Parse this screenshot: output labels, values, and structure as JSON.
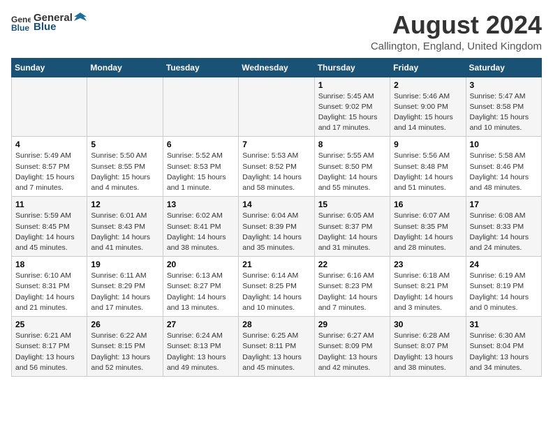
{
  "header": {
    "logo_general": "General",
    "logo_blue": "Blue",
    "main_title": "August 2024",
    "subtitle": "Callington, England, United Kingdom"
  },
  "weekdays": [
    "Sunday",
    "Monday",
    "Tuesday",
    "Wednesday",
    "Thursday",
    "Friday",
    "Saturday"
  ],
  "weeks": [
    [
      {
        "day": "",
        "info": ""
      },
      {
        "day": "",
        "info": ""
      },
      {
        "day": "",
        "info": ""
      },
      {
        "day": "",
        "info": ""
      },
      {
        "day": "1",
        "info": "Sunrise: 5:45 AM\nSunset: 9:02 PM\nDaylight: 15 hours and 17 minutes."
      },
      {
        "day": "2",
        "info": "Sunrise: 5:46 AM\nSunset: 9:00 PM\nDaylight: 15 hours and 14 minutes."
      },
      {
        "day": "3",
        "info": "Sunrise: 5:47 AM\nSunset: 8:58 PM\nDaylight: 15 hours and 10 minutes."
      }
    ],
    [
      {
        "day": "4",
        "info": "Sunrise: 5:49 AM\nSunset: 8:57 PM\nDaylight: 15 hours and 7 minutes."
      },
      {
        "day": "5",
        "info": "Sunrise: 5:50 AM\nSunset: 8:55 PM\nDaylight: 15 hours and 4 minutes."
      },
      {
        "day": "6",
        "info": "Sunrise: 5:52 AM\nSunset: 8:53 PM\nDaylight: 15 hours and 1 minute."
      },
      {
        "day": "7",
        "info": "Sunrise: 5:53 AM\nSunset: 8:52 PM\nDaylight: 14 hours and 58 minutes."
      },
      {
        "day": "8",
        "info": "Sunrise: 5:55 AM\nSunset: 8:50 PM\nDaylight: 14 hours and 55 minutes."
      },
      {
        "day": "9",
        "info": "Sunrise: 5:56 AM\nSunset: 8:48 PM\nDaylight: 14 hours and 51 minutes."
      },
      {
        "day": "10",
        "info": "Sunrise: 5:58 AM\nSunset: 8:46 PM\nDaylight: 14 hours and 48 minutes."
      }
    ],
    [
      {
        "day": "11",
        "info": "Sunrise: 5:59 AM\nSunset: 8:45 PM\nDaylight: 14 hours and 45 minutes."
      },
      {
        "day": "12",
        "info": "Sunrise: 6:01 AM\nSunset: 8:43 PM\nDaylight: 14 hours and 41 minutes."
      },
      {
        "day": "13",
        "info": "Sunrise: 6:02 AM\nSunset: 8:41 PM\nDaylight: 14 hours and 38 minutes."
      },
      {
        "day": "14",
        "info": "Sunrise: 6:04 AM\nSunset: 8:39 PM\nDaylight: 14 hours and 35 minutes."
      },
      {
        "day": "15",
        "info": "Sunrise: 6:05 AM\nSunset: 8:37 PM\nDaylight: 14 hours and 31 minutes."
      },
      {
        "day": "16",
        "info": "Sunrise: 6:07 AM\nSunset: 8:35 PM\nDaylight: 14 hours and 28 minutes."
      },
      {
        "day": "17",
        "info": "Sunrise: 6:08 AM\nSunset: 8:33 PM\nDaylight: 14 hours and 24 minutes."
      }
    ],
    [
      {
        "day": "18",
        "info": "Sunrise: 6:10 AM\nSunset: 8:31 PM\nDaylight: 14 hours and 21 minutes."
      },
      {
        "day": "19",
        "info": "Sunrise: 6:11 AM\nSunset: 8:29 PM\nDaylight: 14 hours and 17 minutes."
      },
      {
        "day": "20",
        "info": "Sunrise: 6:13 AM\nSunset: 8:27 PM\nDaylight: 14 hours and 13 minutes."
      },
      {
        "day": "21",
        "info": "Sunrise: 6:14 AM\nSunset: 8:25 PM\nDaylight: 14 hours and 10 minutes."
      },
      {
        "day": "22",
        "info": "Sunrise: 6:16 AM\nSunset: 8:23 PM\nDaylight: 14 hours and 7 minutes."
      },
      {
        "day": "23",
        "info": "Sunrise: 6:18 AM\nSunset: 8:21 PM\nDaylight: 14 hours and 3 minutes."
      },
      {
        "day": "24",
        "info": "Sunrise: 6:19 AM\nSunset: 8:19 PM\nDaylight: 14 hours and 0 minutes."
      }
    ],
    [
      {
        "day": "25",
        "info": "Sunrise: 6:21 AM\nSunset: 8:17 PM\nDaylight: 13 hours and 56 minutes."
      },
      {
        "day": "26",
        "info": "Sunrise: 6:22 AM\nSunset: 8:15 PM\nDaylight: 13 hours and 52 minutes."
      },
      {
        "day": "27",
        "info": "Sunrise: 6:24 AM\nSunset: 8:13 PM\nDaylight: 13 hours and 49 minutes."
      },
      {
        "day": "28",
        "info": "Sunrise: 6:25 AM\nSunset: 8:11 PM\nDaylight: 13 hours and 45 minutes."
      },
      {
        "day": "29",
        "info": "Sunrise: 6:27 AM\nSunset: 8:09 PM\nDaylight: 13 hours and 42 minutes."
      },
      {
        "day": "30",
        "info": "Sunrise: 6:28 AM\nSunset: 8:07 PM\nDaylight: 13 hours and 38 minutes."
      },
      {
        "day": "31",
        "info": "Sunrise: 6:30 AM\nSunset: 8:04 PM\nDaylight: 13 hours and 34 minutes."
      }
    ]
  ]
}
